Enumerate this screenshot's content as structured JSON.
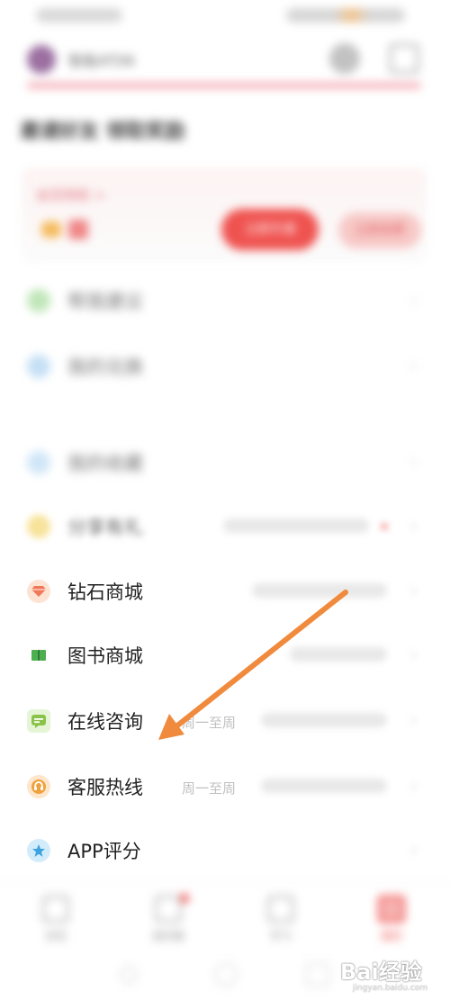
{
  "status_bar": {
    "left_text": "",
    "right_text": ""
  },
  "header": {
    "username": "智能ATD6"
  },
  "section": {
    "title": "邀请好友 领取奖励"
  },
  "vip": {
    "label": "会员特权 >",
    "primary_button": "立即开通",
    "secondary_button": "立即续费"
  },
  "menu": {
    "items": [
      {
        "label": "帮我建议",
        "sub": ""
      },
      {
        "label": "我的兑换",
        "sub": ""
      },
      {
        "label": "我的收藏",
        "sub": ""
      },
      {
        "label": "分享有礼",
        "sub": ""
      },
      {
        "label": "钻石商城",
        "sub": ""
      },
      {
        "label": "图书商城",
        "sub": ""
      },
      {
        "label": "在线咨询",
        "sub": "周一至周"
      },
      {
        "label": "客服热线",
        "sub": "周一至周"
      },
      {
        "label": "APP评分",
        "sub": ""
      }
    ]
  },
  "bottom_nav": {
    "items": [
      {
        "label": "发现"
      },
      {
        "label": "我的圈"
      },
      {
        "label": "学习"
      },
      {
        "label": "我的"
      }
    ]
  },
  "watermark": {
    "main": "Bai经验",
    "sub": "jingyan.baidu.com"
  },
  "colors": {
    "accent": "#ef5350",
    "arrow": "#f08a3c"
  }
}
